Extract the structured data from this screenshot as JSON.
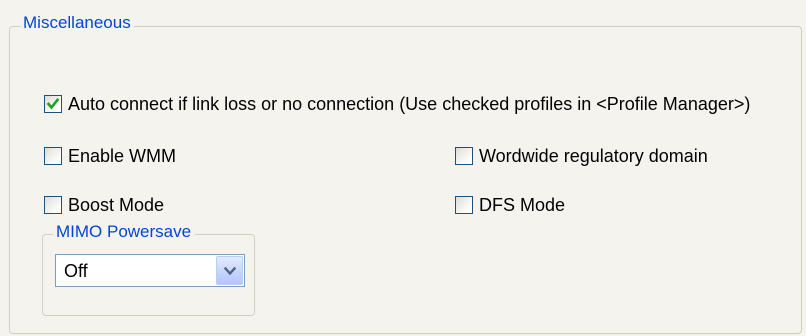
{
  "misc_group": {
    "title": "Miscellaneous"
  },
  "checkboxes": {
    "auto_connect": {
      "label": "Auto connect if link loss or no connection (Use checked profiles in <Profile Manager>)",
      "checked": true
    },
    "enable_wmm": {
      "label": "Enable WMM",
      "checked": false
    },
    "worldwide_domain": {
      "label": "Wordwide regulatory domain",
      "checked": false
    },
    "boost_mode": {
      "label": "Boost Mode",
      "checked": false
    },
    "dfs_mode": {
      "label": "DFS Mode",
      "checked": false
    }
  },
  "mimo_group": {
    "title": "MIMO Powersave",
    "select": {
      "value": "Off",
      "icon": "chevron-down-icon"
    }
  },
  "colors": {
    "panel_background": "#f4f3ee",
    "group_title": "#0046d5",
    "group_border": "#d0d0bf",
    "checkbox_border": "#1c5180",
    "checkmark": "#21a121",
    "dropdown_button": "#c5d5fb",
    "dropdown_arrow": "#4d6185"
  }
}
